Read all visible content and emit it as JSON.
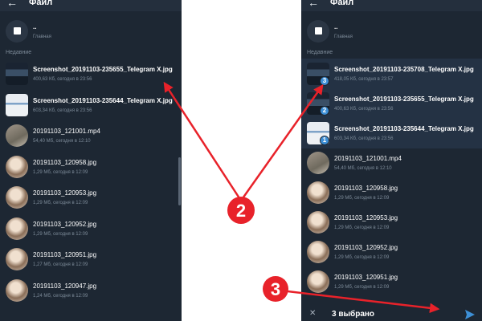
{
  "colors": {
    "accent": "#3d8fd6",
    "annotation": "#e8222a",
    "panel_bg": "#1d2733"
  },
  "left": {
    "title": "Файл",
    "parent": {
      "name": "..",
      "sub": "Главная"
    },
    "section": "Недавние",
    "files": [
      {
        "name": "Screenshot_20191103-235655_Telegram X.jpg",
        "meta": "400,63 Кб, сегодня в 23:56",
        "thumb": "doc-dark"
      },
      {
        "name": "Screenshot_20191103-235644_Telegram X.jpg",
        "meta": "603,34 Кб, сегодня в 23:56",
        "thumb": "doc"
      },
      {
        "name": "20191103_121001.mp4",
        "meta": "54,40 Мб, сегодня в 12:10",
        "thumb": "video"
      },
      {
        "name": "20191103_120958.jpg",
        "meta": "1,29 Мб, сегодня в 12:09",
        "thumb": "photo"
      },
      {
        "name": "20191103_120953.jpg",
        "meta": "1,29 Мб, сегодня в 12:09",
        "thumb": "photo"
      },
      {
        "name": "20191103_120952.jpg",
        "meta": "1,29 Мб, сегодня в 12:09",
        "thumb": "photo"
      },
      {
        "name": "20191103_120951.jpg",
        "meta": "1,27 Мб, сегодня в 12:09",
        "thumb": "photo"
      },
      {
        "name": "20191103_120947.jpg",
        "meta": "1,24 Мб, сегодня в 12:09",
        "thumb": "photo"
      }
    ]
  },
  "right": {
    "title": "Файл",
    "parent": {
      "name": "..",
      "sub": "Главная"
    },
    "section": "Недавние",
    "files": [
      {
        "name": "Screenshot_20191103-235708_Telegram X.jpg",
        "meta": "418,05 Кб, сегодня в 23:57",
        "thumb": "doc-dark",
        "badge": "3"
      },
      {
        "name": "Screenshot_20191103-235655_Telegram X.jpg",
        "meta": "400,63 Кб, сегодня в 23:56",
        "thumb": "doc-dark",
        "badge": "2"
      },
      {
        "name": "Screenshot_20191103-235644_Telegram X.jpg",
        "meta": "603,34 Кб, сегодня в 23:56",
        "thumb": "doc",
        "badge": "1"
      },
      {
        "name": "20191103_121001.mp4",
        "meta": "54,40 Мб, сегодня в 12:10",
        "thumb": "video"
      },
      {
        "name": "20191103_120958.jpg",
        "meta": "1,29 Мб, сегодня в 12:09",
        "thumb": "photo"
      },
      {
        "name": "20191103_120953.jpg",
        "meta": "1,29 Мб, сегодня в 12:09",
        "thumb": "photo"
      },
      {
        "name": "20191103_120952.jpg",
        "meta": "1,29 Мб, сегодня в 12:09",
        "thumb": "photo"
      },
      {
        "name": "20191103_120951.jpg",
        "meta": "1,29 Мб, сегодня в 12:09",
        "thumb": "photo"
      }
    ],
    "bottom": {
      "close_icon": "close-icon",
      "selected": "3 выбрано",
      "send_icon": "send-icon"
    }
  },
  "annotations": {
    "step_a": "2",
    "step_b": "3"
  }
}
